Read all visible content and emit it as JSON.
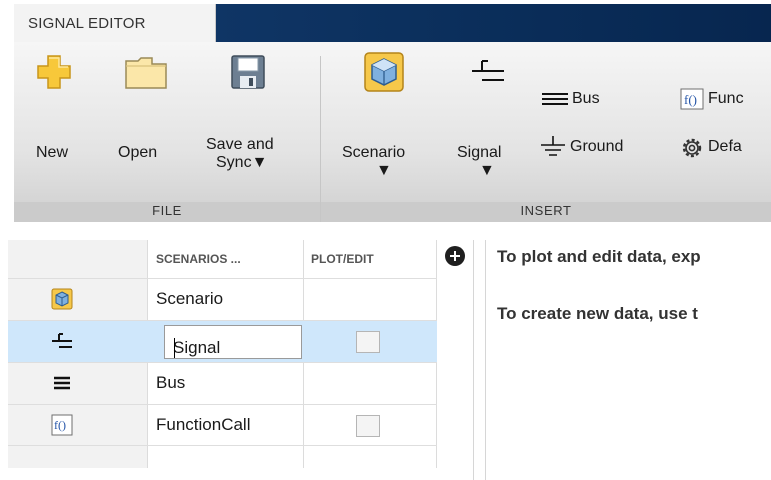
{
  "tabs": {
    "active_label": "SIGNAL EDITOR"
  },
  "toolstrip": {
    "file": {
      "section_label": "FILE",
      "new_label": "New",
      "open_label": "Open",
      "save_label_line1": "Save and",
      "save_label_line2": "Sync"
    },
    "insert": {
      "section_label": "INSERT",
      "scenario_label": "Scenario",
      "signal_label": "Signal",
      "bus_label": "Bus",
      "ground_label": "Ground",
      "function_label": "Func",
      "default_label": "Defa"
    }
  },
  "table": {
    "headers": {
      "scenarios": "SCENARIOS ...",
      "plot_edit": "PLOT/EDIT"
    },
    "rows": [
      {
        "name": "Scenario",
        "icon": "scenario-cube-icon",
        "has_checkbox": false
      },
      {
        "name": "Signal",
        "icon": "signal-icon",
        "has_checkbox": true,
        "editing": true
      },
      {
        "name": "Bus",
        "icon": "bus-icon",
        "has_checkbox": false
      },
      {
        "name": "FunctionCall",
        "icon": "function-call-icon",
        "has_checkbox": true
      }
    ]
  },
  "message": {
    "line1": "To plot and edit data, exp",
    "line2": "To create new data, use t"
  },
  "colors": {
    "tab_bar": "#0a2d59",
    "selection": "#cfe7fb",
    "new_icon": "#f7c83a"
  }
}
